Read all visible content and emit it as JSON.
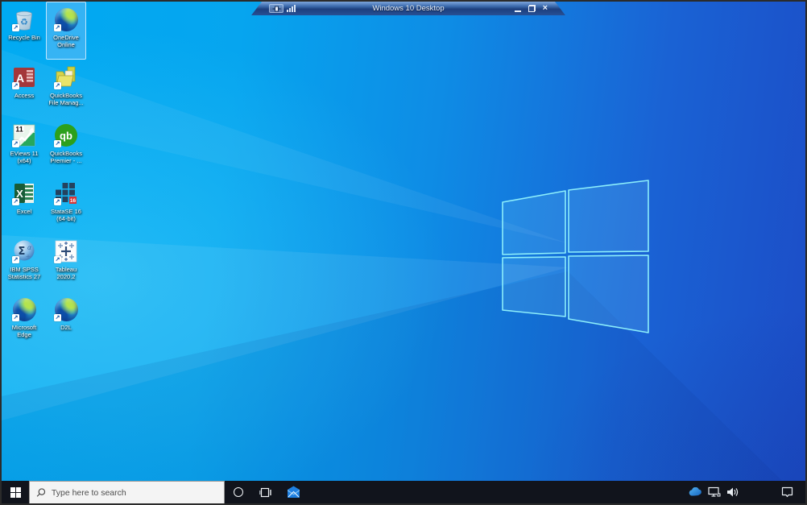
{
  "remote_bar": {
    "title": "Windows 10 Desktop",
    "pin_icon": "pin-icon",
    "signal_icon": "signal-bars-icon",
    "minimize_icon": "minimize-icon",
    "restore_icon": "restore-icon",
    "close_icon": "close-icon"
  },
  "desktop": {
    "icons": [
      {
        "label": "Recycle Bin",
        "icon": "recycle-bin-icon",
        "selected": false
      },
      {
        "label": "OneDrive Online",
        "icon": "edge-browser-icon",
        "selected": true
      },
      {
        "label": "Access",
        "icon": "access-app-icon",
        "selected": false
      },
      {
        "label": "QuickBooks File Manag...",
        "icon": "quickbooks-folder-icon",
        "selected": false
      },
      {
        "label": "EViews 11 (x64)",
        "icon": "eviews-app-icon",
        "selected": false
      },
      {
        "label": "QuickBooks Premier - ...",
        "icon": "quickbooks-app-icon",
        "selected": false
      },
      {
        "label": "Excel",
        "icon": "excel-app-icon",
        "selected": false
      },
      {
        "label": "StataSE 16 (64-bit)",
        "icon": "stata-app-icon",
        "selected": false
      },
      {
        "label": "IBM SPSS Statistics 27",
        "icon": "spss-app-icon",
        "selected": false
      },
      {
        "label": "Tableau 2020.2",
        "icon": "tableau-app-icon",
        "selected": false
      },
      {
        "label": "Microsoft Edge",
        "icon": "edge-browser-icon",
        "selected": false
      },
      {
        "label": "D2L",
        "icon": "edge-browser-icon",
        "selected": false
      }
    ],
    "icon_art": {
      "eviews_number": "11",
      "quickbooks_initials": "qb",
      "access_letter": "A",
      "excel_letter": "X",
      "spss_glyphs": "Σα",
      "stata_badge": "16"
    }
  },
  "taskbar": {
    "start_icon": "windows-start-icon",
    "search": {
      "placeholder": "Type here to search",
      "icon": "search-icon"
    },
    "cortana_icon": "cortana-icon",
    "task_view_icon": "task-view-icon",
    "mail_icon": "mail-icon",
    "tray": {
      "onedrive_icon": "onedrive-cloud-icon",
      "network_icon": "network-icon",
      "volume_icon": "volume-icon",
      "action_center_icon": "action-center-icon"
    }
  },
  "colors": {
    "wallpaper_light": "#00aaf2",
    "wallpaper_dark": "#1c4cc6",
    "taskbar_bg": "#11141c",
    "logo_edge": "#8ceefb",
    "selection_fill": "rgba(130,195,250,0.40)",
    "quickbooks_green": "#2ca01c",
    "access_red": "#a4373a",
    "excel_green": "#185c37"
  }
}
